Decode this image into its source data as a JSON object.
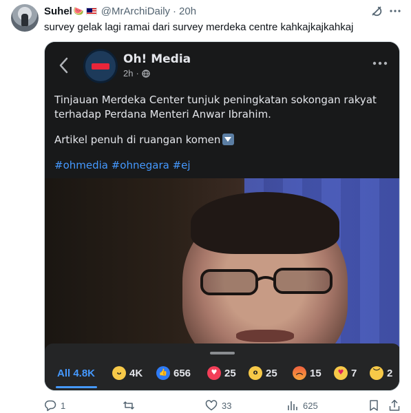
{
  "tweet": {
    "author_name": "Suhel",
    "author_handle": "@MrArchiDaily",
    "separator": "·",
    "time": "20h",
    "text": "survey gelak lagi ramai dari survey merdeka centre kahkajkajkahkaj",
    "name_emoji": "🍉"
  },
  "embedded_post": {
    "page_name": "Oh! Media",
    "time": "2h",
    "meta_separator": "·",
    "paragraph_1": "Tinjauan Merdeka Center tunjuk peningkatan sokongan rakyat terhadap Perdana Menteri Anwar Ibrahim.",
    "paragraph_2": "Artikel penuh di ruangan komen",
    "hashtags": "#ohmedia #ohnegara #ej",
    "reactions": {
      "all_label": "All 4.8K",
      "items": [
        {
          "icon": "haha-reaction-icon",
          "count": "4K"
        },
        {
          "icon": "like-reaction-icon",
          "count": "656"
        },
        {
          "icon": "love-reaction-icon",
          "count": "25"
        },
        {
          "icon": "wow-reaction-icon",
          "count": "25"
        },
        {
          "icon": "angry-reaction-icon",
          "count": "15"
        },
        {
          "icon": "care-reaction-icon",
          "count": "7"
        },
        {
          "icon": "sad-reaction-icon",
          "count": "2"
        }
      ]
    }
  },
  "actions": {
    "reply_count": "1",
    "retweet_count": "",
    "like_count": "33",
    "views_count": "625"
  },
  "colors": {
    "link_blue": "#4599ff",
    "muted_gray": "#536471",
    "facebook_dark": "#18191a"
  }
}
